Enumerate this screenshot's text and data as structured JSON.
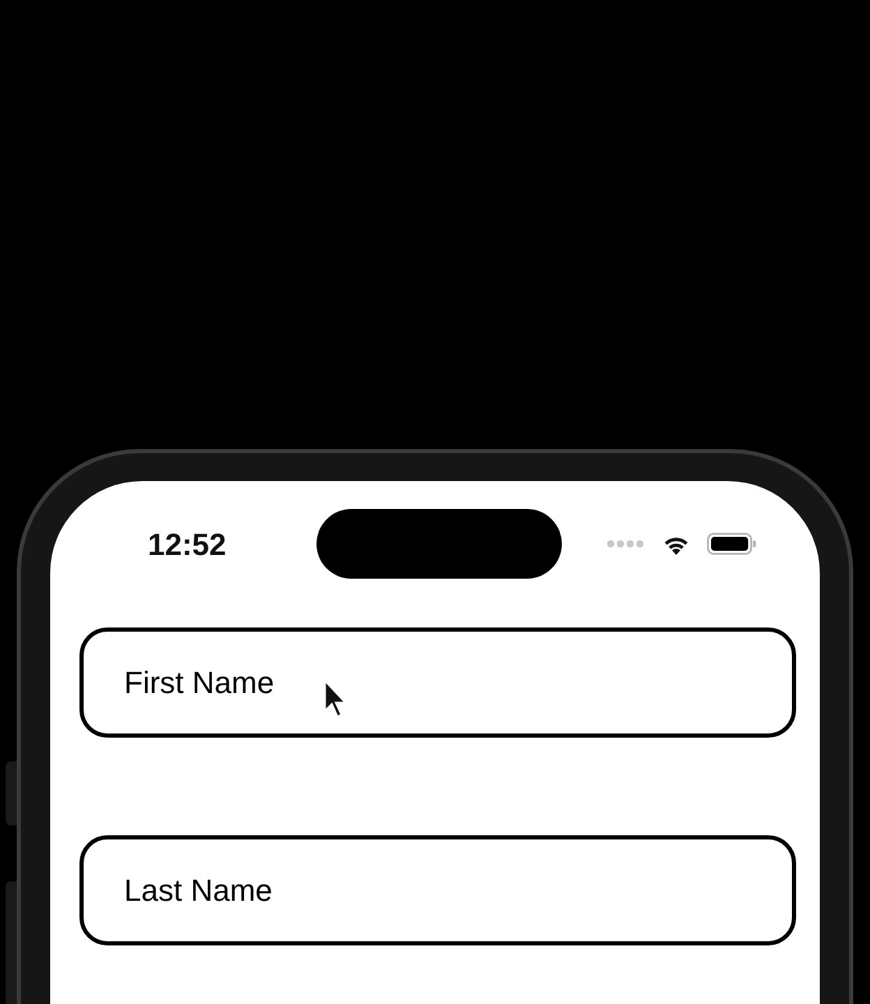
{
  "status_bar": {
    "time": "12:52"
  },
  "fields": [
    {
      "value": "First Name"
    },
    {
      "value": "Last Name"
    }
  ]
}
